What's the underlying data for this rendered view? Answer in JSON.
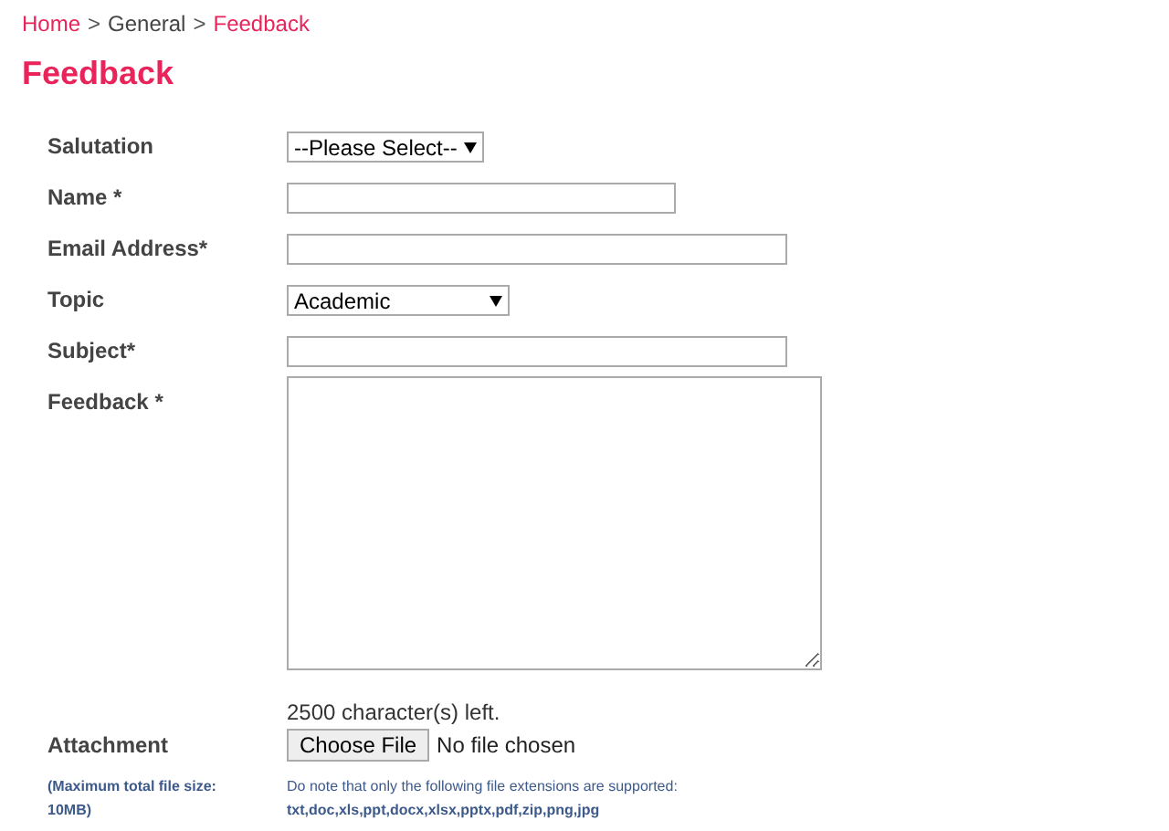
{
  "breadcrumb": [
    {
      "label": "Home",
      "kind": "link"
    },
    {
      "label": "General",
      "kind": "current"
    },
    {
      "label": "Feedback",
      "kind": "link"
    }
  ],
  "separator": ">",
  "title": "Feedback",
  "fields": [
    {
      "label": "Salutation",
      "kind": "select",
      "value": "--Please Select--"
    },
    {
      "label": "Name *",
      "kind": "text"
    },
    {
      "label": "Email Address*",
      "kind": "text"
    },
    {
      "label": "Topic",
      "kind": "select",
      "value": "Academic"
    },
    {
      "label": "Subject*",
      "kind": "text"
    },
    {
      "label": "Feedback *",
      "kind": "textarea"
    }
  ],
  "characters_left": "2500 character(s) left.",
  "attachment": {
    "label": "Attachment",
    "button": "Choose File",
    "status": "No file chosen",
    "size_note": "(Maximum total file size: 10MB)",
    "extensions_note": "Do note that only the following file extensions are supported:",
    "extensions": "txt,doc,xls,ppt,docx,xlsx,pptx,pdf,zip,png,jpg"
  }
}
